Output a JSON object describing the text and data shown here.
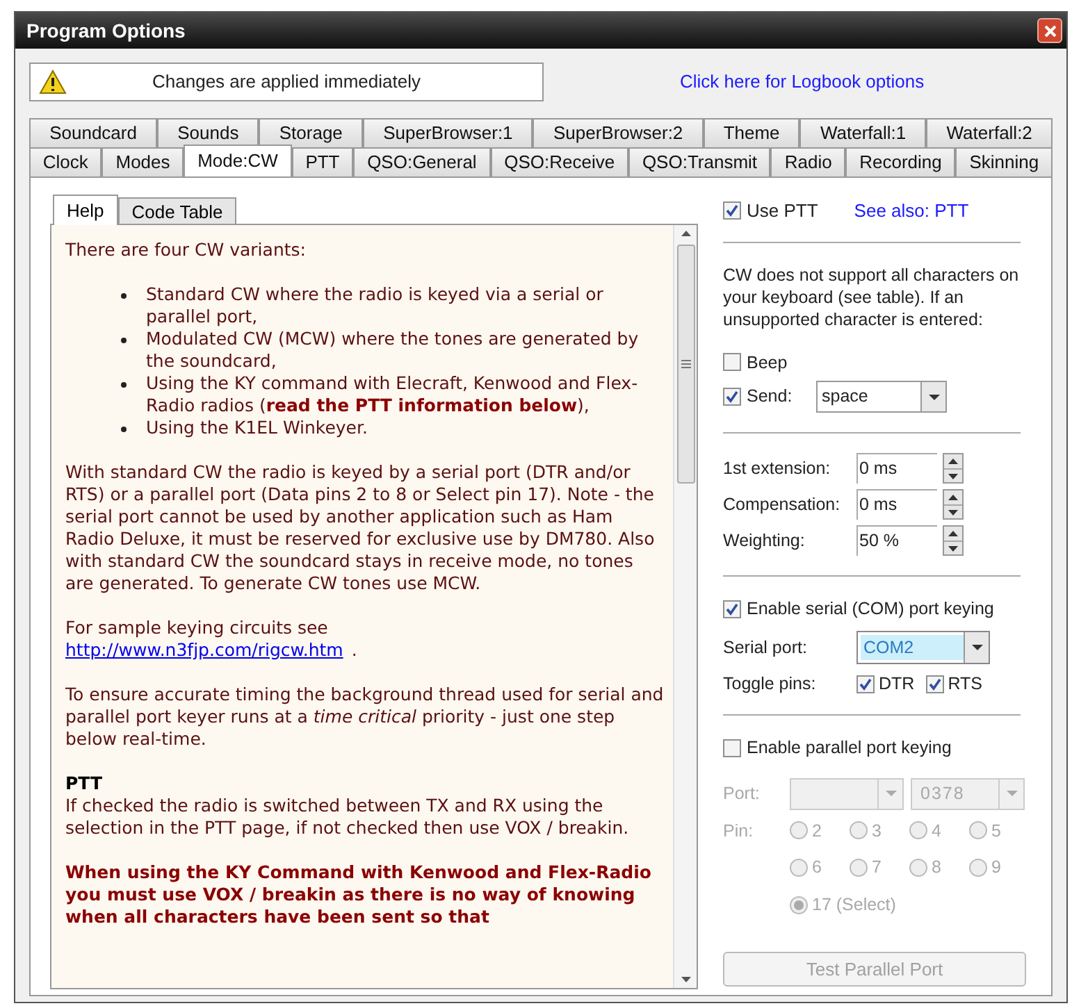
{
  "window": {
    "title": "Program Options"
  },
  "notice": {
    "text": "Changes are applied immediately"
  },
  "logbook_link": "Click here for Logbook options",
  "tab_rows": [
    [
      {
        "label": "Soundcard",
        "selected": false
      },
      {
        "label": "Sounds",
        "selected": false
      },
      {
        "label": "Storage",
        "selected": false
      },
      {
        "label": "SuperBrowser:1",
        "selected": false
      },
      {
        "label": "SuperBrowser:2",
        "selected": false
      },
      {
        "label": "Theme",
        "selected": false
      },
      {
        "label": "Waterfall:1",
        "selected": false
      },
      {
        "label": "Waterfall:2",
        "selected": false
      }
    ],
    [
      {
        "label": "Clock",
        "selected": false
      },
      {
        "label": "Modes",
        "selected": false
      },
      {
        "label": "Mode:CW",
        "selected": true
      },
      {
        "label": "PTT",
        "selected": false
      },
      {
        "label": "QSO:General",
        "selected": false
      },
      {
        "label": "QSO:Receive",
        "selected": false
      },
      {
        "label": "QSO:Transmit",
        "selected": false
      },
      {
        "label": "Radio",
        "selected": false
      },
      {
        "label": "Recording",
        "selected": false
      },
      {
        "label": "Skinning",
        "selected": false
      }
    ]
  ],
  "help_tabs": [
    {
      "label": "Help",
      "selected": true
    },
    {
      "label": "Code Table",
      "selected": false
    }
  ],
  "help": [
    {
      "kind": "paragraph",
      "text": "There are four CW variants:"
    },
    {
      "kind": "bullets",
      "items": [
        "Standard CW where the radio is keyed via a serial or parallel port,",
        "Modulated CW (MCW) where the tones are generated by the soundcard,",
        "Using the KY command with Elecraft, Kenwood and Flex-Radio radios (**read the PTT information below**),",
        "Using the K1EL Winkeyer."
      ]
    },
    {
      "kind": "paragraph",
      "text": "With standard CW the radio is keyed by a serial port (DTR and/or RTS) or a parallel port (Data pins 2 to 8 or Select pin 17). Note - the serial port cannot be used by another application such as Ham Radio Deluxe, it must be reserved for exclusive use by DM780. Also with standard CW the soundcard stays in receive mode, no tones are generated. To generate CW tones use MCW."
    },
    {
      "kind": "link_paragraph",
      "text": "For sample keying circuits see",
      "link": "http://www.n3fjp.com/rigcw.htm",
      "after": "."
    },
    {
      "kind": "paragraph",
      "text": "To ensure accurate timing the background thread used for serial and parallel port keyer runs at a *time critical* priority - just one step below real-time."
    },
    {
      "kind": "heading",
      "text": "PTT"
    },
    {
      "kind": "paragraph",
      "text": "If checked the radio is switched between TX and RX using the selection in the PTT page, if not checked then use VOX / breakin."
    },
    {
      "kind": "warning",
      "text": "When using the KY Command with Kenwood and Flex-Radio you must use VOX / breakin as there is no way of knowing when all characters have been sent so that"
    }
  ],
  "use_ptt": {
    "label": "Use PTT",
    "checked": true
  },
  "see_also": "See also: PTT",
  "unsupported_text": "CW does not support all characters on your keyboard (see table). If an unsupported character  is entered:",
  "beep": {
    "label": "Beep",
    "checked": false
  },
  "send": {
    "label": "Send:",
    "checked": true,
    "value": "space"
  },
  "timings": [
    {
      "label": "1st extension:",
      "value": "0 ms"
    },
    {
      "label": "Compensation:",
      "value": "0 ms"
    },
    {
      "label": "Weighting:",
      "value": "50 %"
    }
  ],
  "serial": {
    "label": "Enable serial (COM) port keying",
    "checked": true,
    "port_label": "Serial port:",
    "port": "COM2",
    "toggle_label": "Toggle pins:",
    "pins": [
      {
        "label": "DTR",
        "checked": true
      },
      {
        "label": "RTS",
        "checked": true
      }
    ]
  },
  "parallel": {
    "label": "Enable parallel port keying",
    "checked": false,
    "disabled": true,
    "port_label": "Port:",
    "address": "0378",
    "pin_label": "Pin:",
    "pins": [
      {
        "label": "2",
        "selected": false
      },
      {
        "label": "3",
        "selected": false
      },
      {
        "label": "4",
        "selected": false
      },
      {
        "label": "5",
        "selected": false
      },
      {
        "label": "6",
        "selected": false
      },
      {
        "label": "7",
        "selected": false
      },
      {
        "label": "8",
        "selected": false
      },
      {
        "label": "9",
        "selected": false
      },
      {
        "label": "17 (Select)",
        "selected": true
      }
    ],
    "test_button": "Test Parallel Port"
  }
}
